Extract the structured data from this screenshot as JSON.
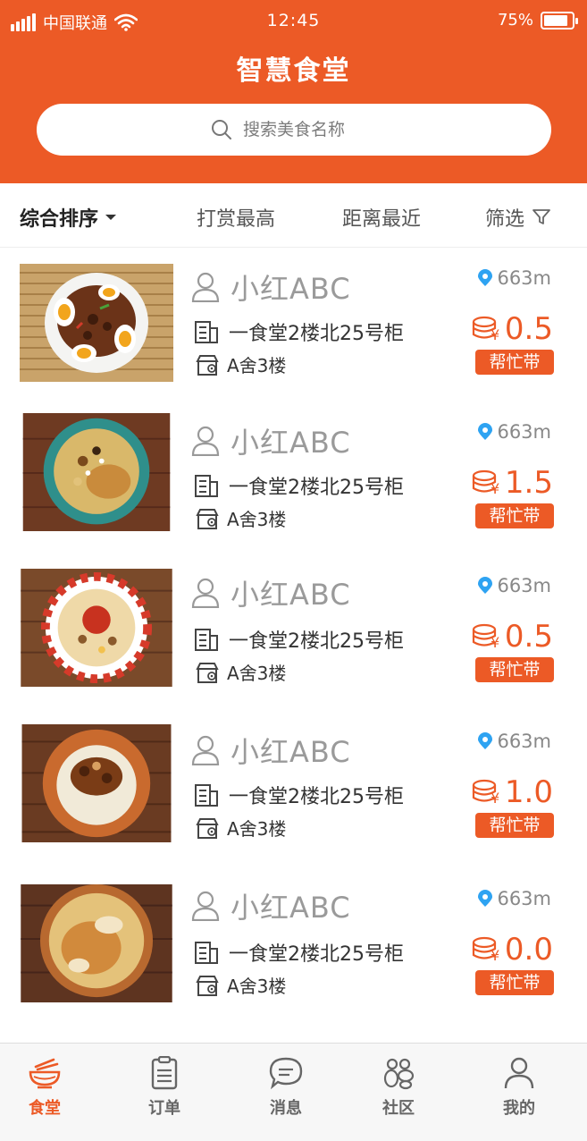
{
  "status": {
    "carrier": "中国联通",
    "time": "12:45",
    "battery": "75%"
  },
  "header": {
    "title": "智慧食堂",
    "search_placeholder": "搜索美食名称"
  },
  "sort": {
    "comprehensive": "综合排序",
    "top_tip": "打赏最高",
    "nearest": "距离最近",
    "filter": "筛选"
  },
  "items": [
    {
      "user": "小红ABC",
      "address": "一食堂2楼北25号柜",
      "dorm": "A舍3楼",
      "distance": "663m",
      "price": "0.5",
      "action": "帮忙带"
    },
    {
      "user": "小红ABC",
      "address": "一食堂2楼北25号柜",
      "dorm": "A舍3楼",
      "distance": "663m",
      "price": "1.5",
      "action": "帮忙带"
    },
    {
      "user": "小红ABC",
      "address": "一食堂2楼北25号柜",
      "dorm": "A舍3楼",
      "distance": "663m",
      "price": "0.5",
      "action": "帮忙带"
    },
    {
      "user": "小红ABC",
      "address": "一食堂2楼北25号柜",
      "dorm": "A舍3楼",
      "distance": "663m",
      "price": "1.0",
      "action": "帮忙带"
    },
    {
      "user": "小红ABC",
      "address": "一食堂2楼北25号柜",
      "dorm": "A舍3楼",
      "distance": "663m",
      "price": "0.0",
      "action": "帮忙带"
    }
  ],
  "tabs": [
    {
      "label": "食堂",
      "icon": "canteen-bowl-icon",
      "active": true
    },
    {
      "label": "订单",
      "icon": "clipboard-icon",
      "active": false
    },
    {
      "label": "消息",
      "icon": "chat-bubble-icon",
      "active": false
    },
    {
      "label": "社区",
      "icon": "community-icon",
      "active": false
    },
    {
      "label": "我的",
      "icon": "user-icon",
      "active": false
    }
  ],
  "colors": {
    "primary": "#ec5a26",
    "accent_blue": "#2ea3f2"
  }
}
